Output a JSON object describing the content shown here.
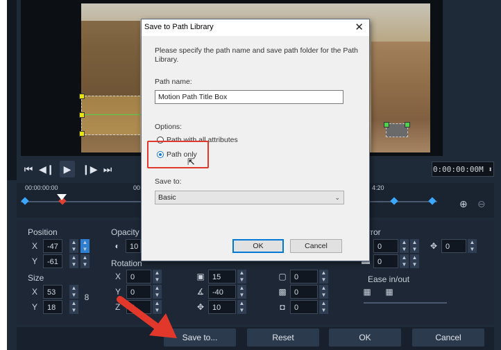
{
  "dialog": {
    "title": "Save to Path Library",
    "description": "Please specify the path name and save path folder for the Path Library.",
    "path_name_label": "Path name:",
    "path_name_value": "Motion Path Title Box",
    "options_label": "Options:",
    "option_all": "Path with all attributes",
    "option_path_only": "Path only",
    "selected_option": "Path only",
    "save_to_label": "Save to:",
    "save_to_value": "Basic",
    "ok_label": "OK",
    "cancel_label": "Cancel",
    "close_icon": "close-icon"
  },
  "transport": {
    "timecode": "0:00:00:00",
    "timecode_suffix": "M"
  },
  "timeline": {
    "start_time": "00:00:00:00",
    "mid_time": "00",
    "end_time": "4:20"
  },
  "properties": {
    "position": {
      "label": "Position",
      "x": "-47",
      "y": "-61"
    },
    "size": {
      "label": "Size",
      "x": "53",
      "y": "18"
    },
    "opacity": {
      "label": "Opacity",
      "value": "10"
    },
    "rotation": {
      "label": "Rotation",
      "x": "0",
      "y": "0",
      "z": "0"
    },
    "col3": {
      "v1": "15",
      "v2": "-40",
      "v3": "10"
    },
    "col4": {
      "v1": "0",
      "v2": "0",
      "v3": "0"
    },
    "mirror": {
      "label": "rror",
      "v1": "0",
      "v2": "0",
      "v3": "0"
    },
    "ease": {
      "label": "Ease in/out"
    },
    "axis_x": "X",
    "axis_y": "Y",
    "axis_z": "Z"
  },
  "bottom": {
    "save_to": "Save to...",
    "reset": "Reset",
    "ok": "OK",
    "cancel": "Cancel"
  },
  "colors": {
    "app_bg": "#1f2a38",
    "accent_blue": "#3ba7ff",
    "highlight_red": "#e2372b"
  }
}
